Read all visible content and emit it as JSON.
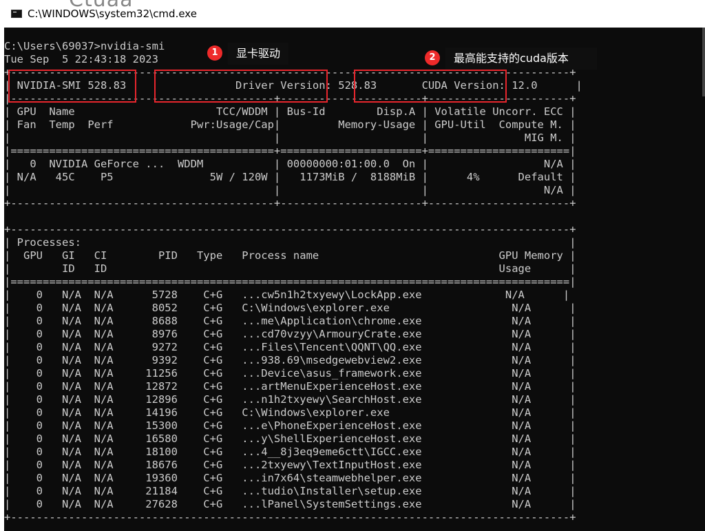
{
  "window": {
    "title": "C:\\WINDOWS\\system32\\cmd.exe",
    "background_text": "Ctuaa"
  },
  "terminal_lines": [
    "C:\\Users\\69037>nvidia-smi",
    "Tue Sep  5 22:43:18 2023",
    "+---------------------------------------------------------------------------------------+",
    "| NVIDIA-SMI 528.83                 Driver Version: 528.83       CUDA Version: 12.0      |",
    "|-----------------------------------------+----------------------+----------------------+",
    "| GPU  Name                      TCC/WDDM | Bus-Id        Disp.A | Volatile Uncorr. ECC |",
    "| Fan  Temp  Perf            Pwr:Usage/Cap|         Memory-Usage | GPU-Util  Compute M. |",
    "|                                         |                      |               MIG M. |",
    "|=========================================+======================+======================|",
    "|   0  NVIDIA GeForce ...  WDDM           | 00000000:01:00.0  On |                  N/A |",
    "| N/A   45C    P5               5W / 120W |   1173MiB /  8188MiB |      4%      Default |",
    "|                                         |                      |                  N/A |",
    "+-----------------------------------------+----------------------+----------------------+",
    "",
    "+---------------------------------------------------------------------------------------+",
    "| Processes:                                                                            |",
    "|  GPU   GI   CI        PID   Type   Process name                            GPU Memory |",
    "|        ID   ID                                                             Usage      |",
    "|=======================================================================================|",
    "|    0   N/A  N/A      5728    C+G   ...cw5n1h2txyewy\\LockApp.exe             N/A      |",
    "|    0   N/A  N/A      8052    C+G   C:\\Windows\\explorer.exe                   N/A      |",
    "|    0   N/A  N/A      8688    C+G   ...me\\Application\\chrome.exe              N/A      |",
    "|    0   N/A  N/A      8976    C+G   ...cd70vzyy\\ArmouryCrate.exe              N/A      |",
    "|    0   N/A  N/A      9272    C+G   ...Files\\Tencent\\QQNT\\QQ.exe              N/A      |",
    "|    0   N/A  N/A      9392    C+G   ...938.69\\msedgewebview2.exe              N/A      |",
    "|    0   N/A  N/A     11256    C+G   ...Device\\asus_framework.exe              N/A      |",
    "|    0   N/A  N/A     12872    C+G   ...artMenuExperienceHost.exe              N/A      |",
    "|    0   N/A  N/A     12896    C+G   ...n1h2txyewy\\SearchHost.exe              N/A      |",
    "|    0   N/A  N/A     14196    C+G   C:\\Windows\\explorer.exe                   N/A      |",
    "|    0   N/A  N/A     15300    C+G   ...e\\PhoneExperienceHost.exe              N/A      |",
    "|    0   N/A  N/A     16580    C+G   ...y\\ShellExperienceHost.exe              N/A      |",
    "|    0   N/A  N/A     18100    C+G   ...4__8j3eq9eme6ctt\\IGCC.exe              N/A      |",
    "|    0   N/A  N/A     18676    C+G   ...2txyewy\\TextInputHost.exe              N/A      |",
    "|    0   N/A  N/A     19360    C+G   ...in7x64\\steamwebhelper.exe              N/A      |",
    "|    0   N/A  N/A     21184    C+G   ...tudio\\Installer\\setup.exe              N/A      |",
    "|    0   N/A  N/A     27628    C+G   ...lPanel\\SystemSettings.exe              N/A      |",
    "+---------------------------------------------------------------------------------------+"
  ],
  "annotations": {
    "badge1": "1",
    "label1": "显卡驱动",
    "badge2": "2",
    "label2": "最高能支持的cuda版本"
  },
  "colors": {
    "terminal_bg": "#0c0c0c",
    "terminal_fg": "#cccccc",
    "highlight_red": "#e8262d"
  }
}
